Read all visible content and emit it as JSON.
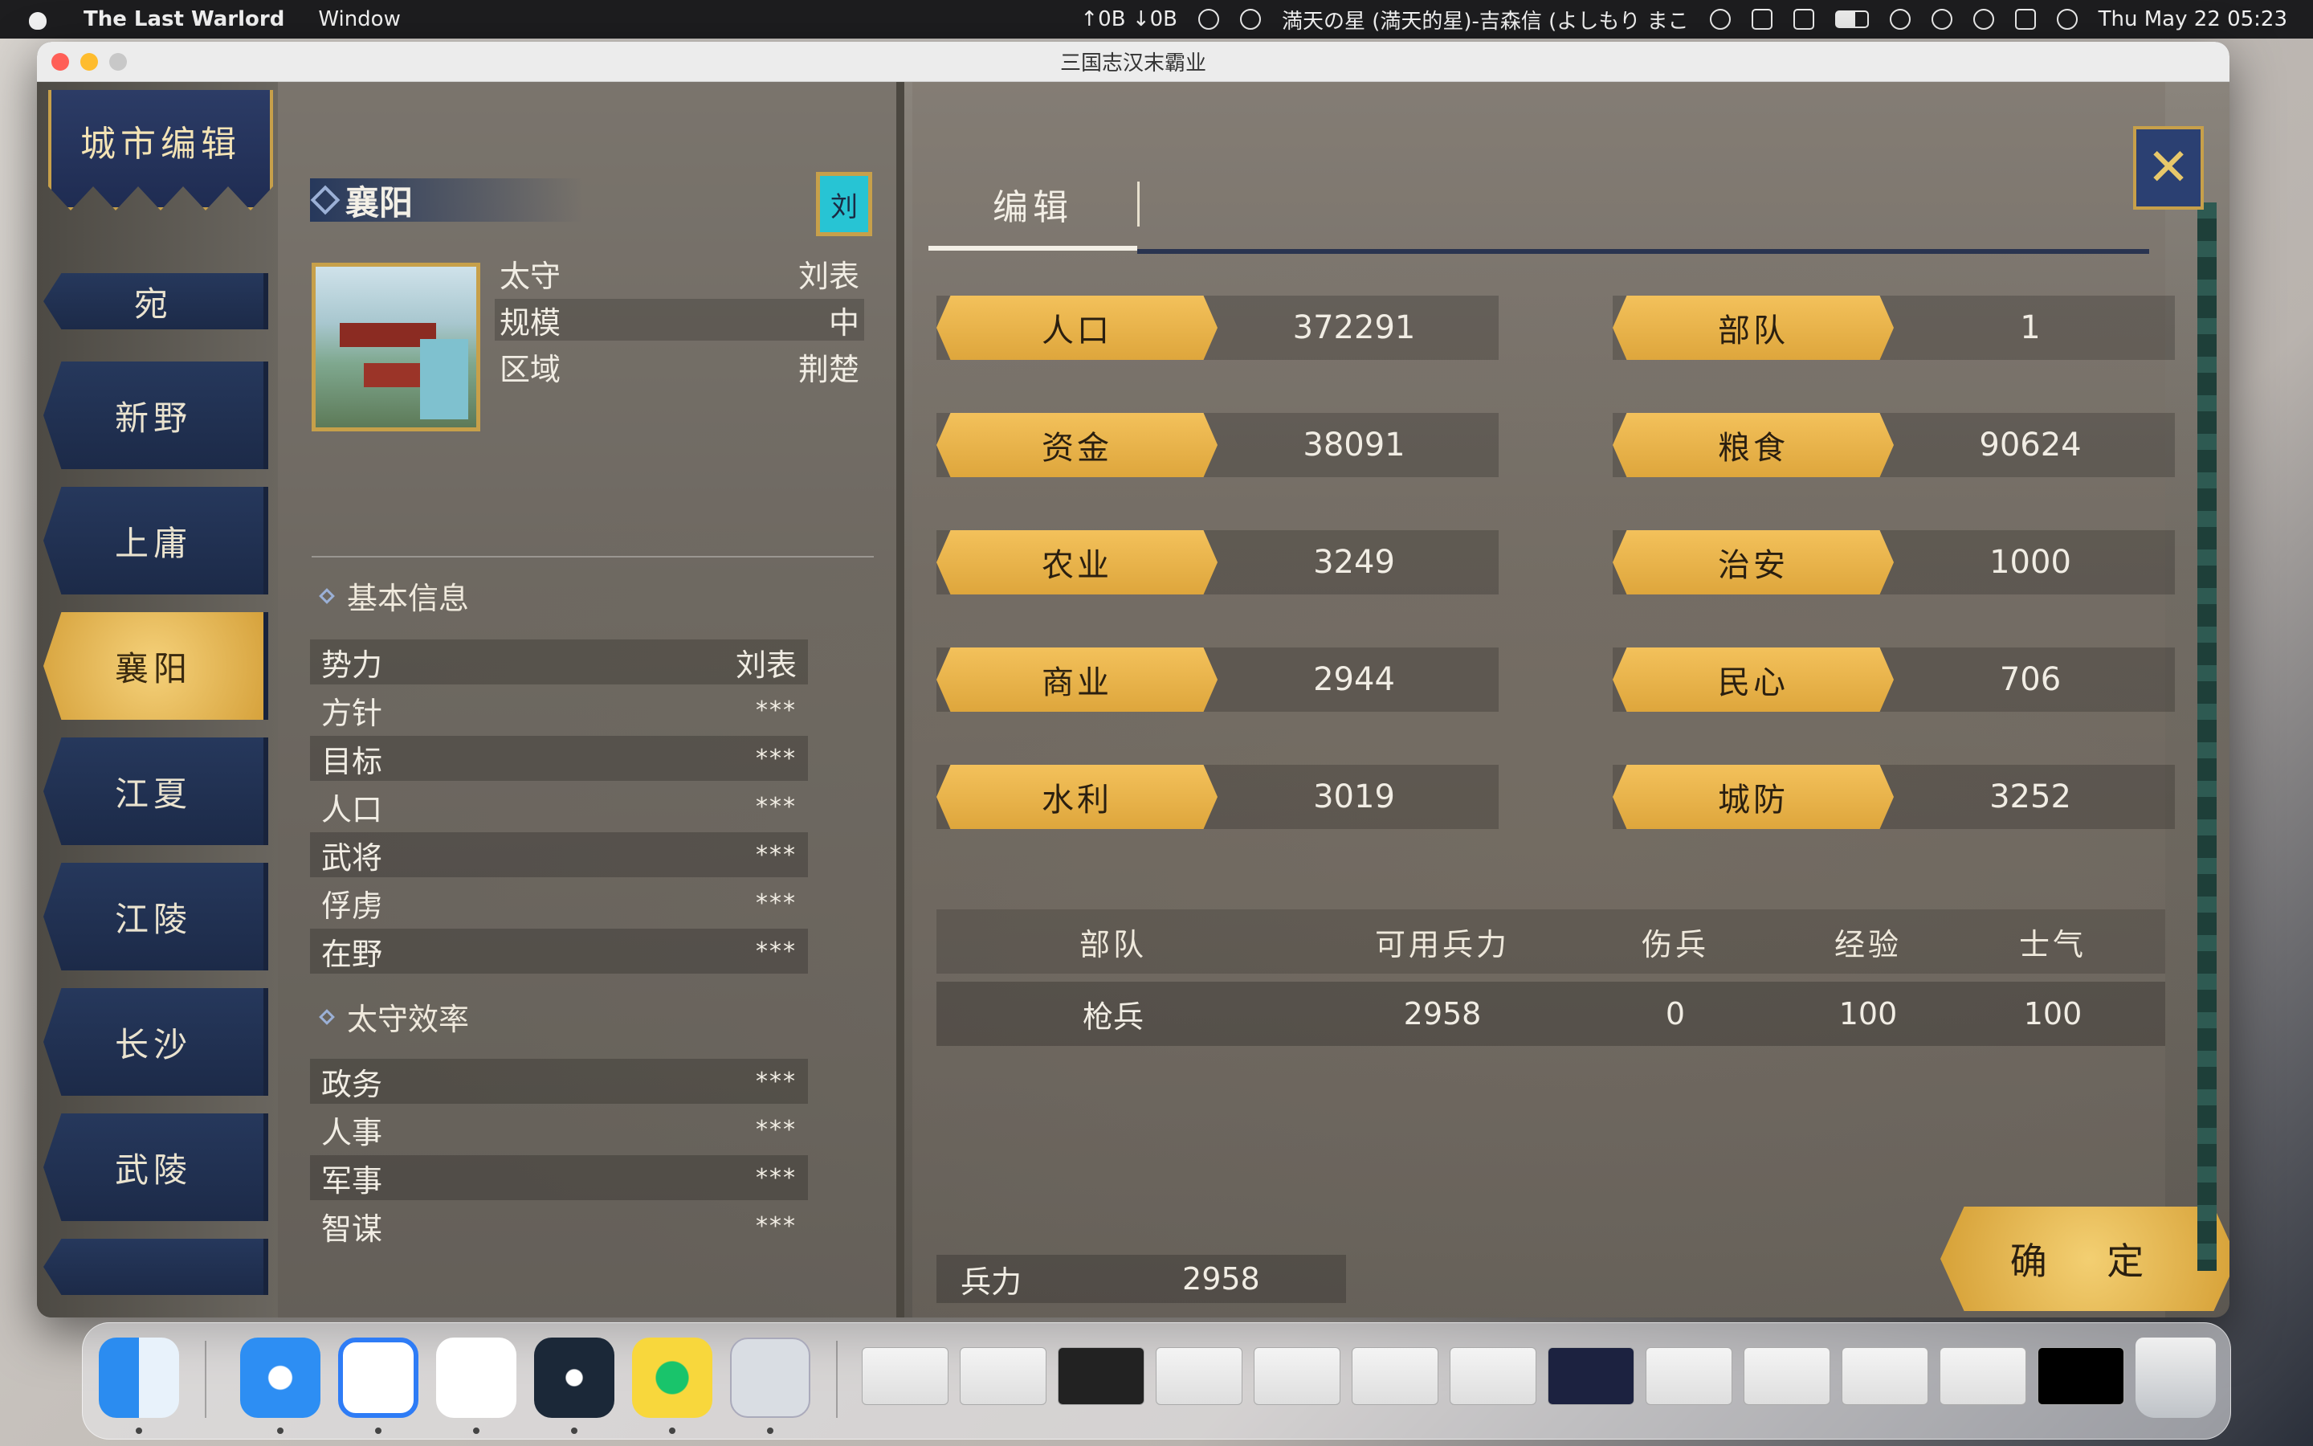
{
  "menubar": {
    "app_name": "The Last Warlord",
    "menu_window": "Window",
    "network": "↑0B ↓0B",
    "now_playing": "満天の星 (満天的星)-吉森信 (よしもり まこ",
    "datetime": "Thu May 22  05:23"
  },
  "window": {
    "title": "三国志汉末霸业"
  },
  "city_list": {
    "banner": "城市编辑",
    "items": [
      {
        "label": "宛"
      },
      {
        "label": "新野"
      },
      {
        "label": "上庸"
      },
      {
        "label": "襄阳"
      },
      {
        "label": "江夏"
      },
      {
        "label": "江陵"
      },
      {
        "label": "长沙"
      },
      {
        "label": "武陵"
      }
    ],
    "active": "襄阳"
  },
  "city_info": {
    "name": "襄阳",
    "ruler_flag": "刘",
    "governor_label": "太守",
    "governor_value": "刘表",
    "scale_label": "规模",
    "scale_value": "中",
    "region_label": "区域",
    "region_value": "荆楚",
    "basic_title": "基本信息",
    "basic": [
      {
        "label": "势力",
        "value": "刘表"
      },
      {
        "label": "方针",
        "value": "***"
      },
      {
        "label": "目标",
        "value": "***"
      },
      {
        "label": "人口",
        "value": "***"
      },
      {
        "label": "武将",
        "value": "***"
      },
      {
        "label": "俘虏",
        "value": "***"
      },
      {
        "label": "在野",
        "value": "***"
      }
    ],
    "eff_title": "太守效率",
    "efficiency": [
      {
        "label": "政务",
        "value": "***"
      },
      {
        "label": "人事",
        "value": "***"
      },
      {
        "label": "军事",
        "value": "***"
      },
      {
        "label": "智谋",
        "value": "***"
      }
    ]
  },
  "edit": {
    "tab_label": "编辑",
    "stats_left": [
      {
        "label": "人口",
        "value": "372291"
      },
      {
        "label": "资金",
        "value": "38091"
      },
      {
        "label": "农业",
        "value": "3249"
      },
      {
        "label": "商业",
        "value": "2944"
      },
      {
        "label": "水利",
        "value": "3019"
      }
    ],
    "stats_right": [
      {
        "label": "部队",
        "value": "1"
      },
      {
        "label": "粮食",
        "value": "90624"
      },
      {
        "label": "治安",
        "value": "1000"
      },
      {
        "label": "民心",
        "value": "706"
      },
      {
        "label": "城防",
        "value": "3252"
      }
    ],
    "troop_headers": [
      "部队",
      "可用兵力",
      "伤兵",
      "经验",
      "士气"
    ],
    "troop_rows": [
      [
        "枪兵",
        "2958",
        "0",
        "100",
        "100"
      ]
    ],
    "force_label": "兵力",
    "force_value": "2958",
    "confirm_label": "确 定"
  },
  "colors": {
    "gold_button": "#e3ad45",
    "navy_button": "#22345a",
    "panel_text": "#f1ede4"
  }
}
